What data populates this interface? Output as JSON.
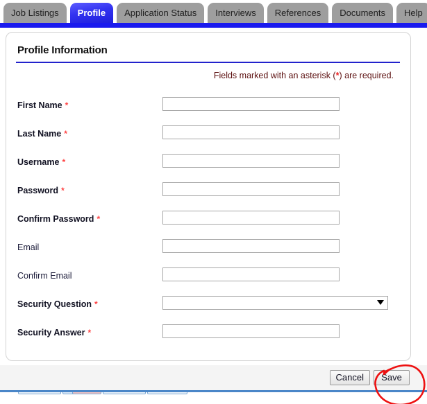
{
  "tabs": [
    {
      "label": "Job Listings",
      "active": false
    },
    {
      "label": "Profile",
      "active": true
    },
    {
      "label": "Application Status",
      "active": false
    },
    {
      "label": "Interviews",
      "active": false
    },
    {
      "label": "References",
      "active": false
    },
    {
      "label": "Documents",
      "active": false
    },
    {
      "label": "Help",
      "active": false
    }
  ],
  "panel": {
    "title": "Profile Information",
    "required_note_prefix": "Fields marked with an asterisk (",
    "required_note_asterisk": "*",
    "required_note_suffix": ") are required."
  },
  "form": {
    "fields": [
      {
        "label": "First Name",
        "required": true,
        "star": "*",
        "type": "text",
        "value": "",
        "placeholder": ""
      },
      {
        "label": "Last Name",
        "required": true,
        "star": "*",
        "type": "text",
        "value": "",
        "placeholder": ""
      },
      {
        "label": "Username",
        "required": true,
        "star": "*",
        "type": "text",
        "value": "",
        "placeholder": ""
      },
      {
        "label": "Password",
        "required": true,
        "star": "*",
        "type": "text",
        "value": "",
        "placeholder": ""
      },
      {
        "label": "Confirm Password",
        "required": true,
        "star": "*",
        "type": "text",
        "value": "",
        "placeholder": ""
      },
      {
        "label": "Email",
        "required": false,
        "star": "",
        "type": "text",
        "value": "",
        "placeholder": ""
      },
      {
        "label": "Confirm Email",
        "required": false,
        "star": "",
        "type": "text",
        "value": "",
        "placeholder": ""
      },
      {
        "label": "Security Question",
        "required": true,
        "star": "*",
        "type": "select",
        "value": "",
        "placeholder": ""
      },
      {
        "label": "Security Answer",
        "required": true,
        "star": "*",
        "type": "text",
        "value": "",
        "placeholder": ""
      }
    ]
  },
  "footer": {
    "cancel_label": "Cancel",
    "save_label": "Save"
  },
  "annotation": {
    "shape": "hand-drawn-ellipse",
    "color": "#ee1111",
    "target": "save-button"
  },
  "colors": {
    "active_tab": "#2222e0",
    "inactive_tab": "#9e9e9e",
    "blue_bar": "#1a1aee",
    "title_rule": "#2222cc",
    "required_text": "#5c1010",
    "asterisk": "#ff4444",
    "annotation": "#ee1111"
  }
}
